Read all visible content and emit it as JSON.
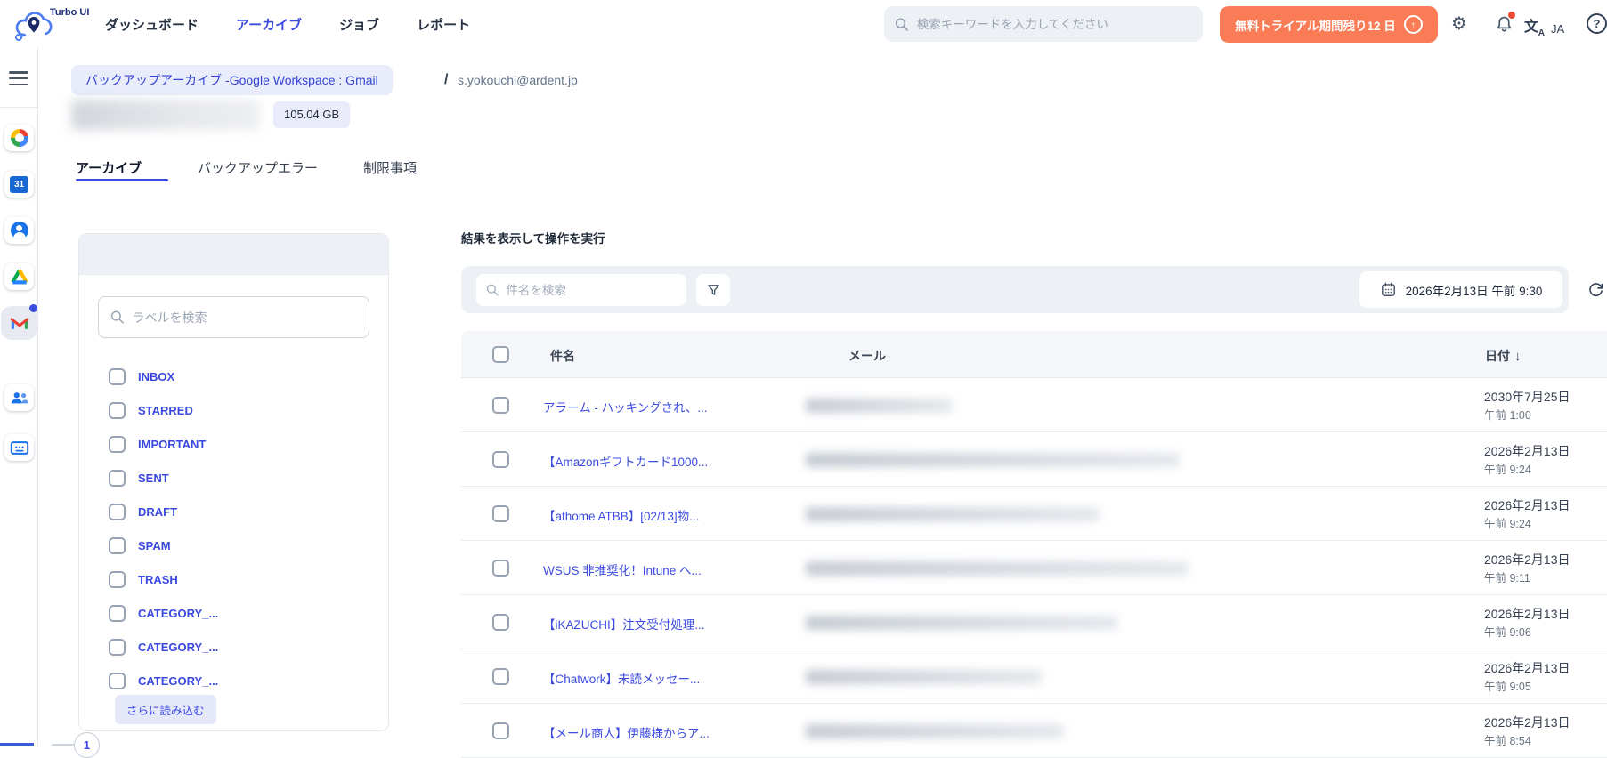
{
  "colors": {
    "accent": "#3b4be0",
    "trial": "#f97c57",
    "notification": "#e94b35"
  },
  "topbar": {
    "brand": "Turbo UI",
    "nav": [
      {
        "label": "ダッシュボード",
        "active": false
      },
      {
        "label": "アーカイブ",
        "active": true
      },
      {
        "label": "ジョブ",
        "active": false
      },
      {
        "label": "レポート",
        "active": false
      }
    ],
    "search_placeholder": "検索キーワードを入力してください",
    "trial_label": "無料トライアル期間残り12 日",
    "language_code": "JA",
    "help_label": "?"
  },
  "breadcrumb": {
    "primary": "バックアップアーカイブ -Google Workspace : Gmail",
    "separator": "/",
    "current": "s.yokouchi@ardent.jp"
  },
  "summary": {
    "size": "105.04 GB"
  },
  "tabs": [
    "アーカイブ",
    "バックアップエラー",
    "制限事項"
  ],
  "rail": {
    "calendar_day": "31"
  },
  "labels": {
    "search_placeholder": "ラベルを検索",
    "items": [
      "INBOX",
      "STARRED",
      "IMPORTANT",
      "SENT",
      "DRAFT",
      "SPAM",
      "TRASH",
      "CATEGORY_...",
      "CATEGORY_...",
      "CATEGORY_..."
    ],
    "load_more": "さらに読み込む",
    "page": "1"
  },
  "results": {
    "title": "結果を表示して操作を実行",
    "search_placeholder": "件名を検索",
    "datetime": "2026年2月13日 午前 9:30",
    "columns": {
      "subject": "件名",
      "mail": "メール",
      "date": "日付"
    },
    "rows": [
      {
        "subject": "アラーム - ハッキングされ、...",
        "date": "2030年7月25日",
        "time": "午前 1:00",
        "redacted_width": 165
      },
      {
        "subject": "【Amazonギフトカード1000...",
        "date": "2026年2月13日",
        "time": "午前 9:24",
        "redacted_width": 420
      },
      {
        "subject": "【athome ATBB】[02/13]物...",
        "date": "2026年2月13日",
        "time": "午前 9:24",
        "redacted_width": 330
      },
      {
        "subject": "WSUS 非推奨化！Intune へ...",
        "date": "2026年2月13日",
        "time": "午前 9:11",
        "redacted_width": 430
      },
      {
        "subject": "【iKAZUCHI】注文受付処理...",
        "date": "2026年2月13日",
        "time": "午前 9:06",
        "redacted_width": 350
      },
      {
        "subject": "【Chatwork】未読メッセー...",
        "date": "2026年2月13日",
        "time": "午前 9:05",
        "redacted_width": 265
      },
      {
        "subject": "【メール商人】伊藤様からア...",
        "date": "2026年2月13日",
        "time": "午前 8:54",
        "redacted_width": 290
      }
    ]
  }
}
